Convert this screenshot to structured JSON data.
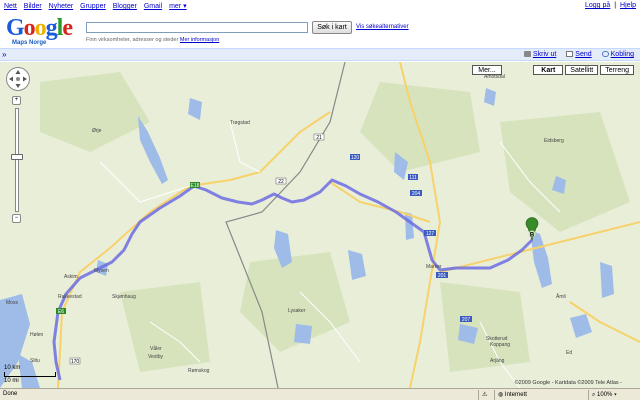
{
  "topnav": {
    "items": [
      "Nett",
      "Bilder",
      "Nyheter",
      "Grupper",
      "Blogger",
      "Gmail",
      "mer ▾"
    ],
    "login": "Logg på",
    "separator": "|",
    "help": "Hjelp"
  },
  "header": {
    "logo_text": "Google",
    "logo_sub": "Maps Norge",
    "search_value": "",
    "search_button": "Søk i kart",
    "options_link": "Vis søkealternativer",
    "hint_text": "Finn virksomheter, adresser og steder",
    "hint_link": "Mer informasjon"
  },
  "toolbar": {
    "collapse_glyph": "»",
    "print": "Skriv ut",
    "send": "Send",
    "link": "Kobling"
  },
  "map": {
    "maptypes": [
      "Kart",
      "Satellitt",
      "Terreng"
    ],
    "active_type": "Kart",
    "more": "Mer...",
    "scale_km": "10 km",
    "scale_mi": "10 mi",
    "copyright": "©2009 Google - Kartdata ©2009 Tele Atlas -",
    "marker_label": "B",
    "towns": [
      "Moss",
      "Hølen",
      "Askim",
      "Mysen",
      "Rakkestad",
      "Ørje",
      "Trøgstad",
      "Eidsberg",
      "Skjønhaug",
      "Åmotsdal",
      "Slitu",
      "Vestby",
      "Våler",
      "Rømskog",
      "Marker",
      "Skotterud",
      "Koppang",
      "Åmli",
      "Lysaker",
      "Arjäng",
      "Ed"
    ],
    "road_numbers": [
      "E6",
      "E18",
      "22",
      "21",
      "127",
      "201",
      "120",
      "170",
      "111",
      "204",
      "207"
    ]
  },
  "statusbar": {
    "status": "Done",
    "zone": "Internett",
    "zoom": "100%"
  },
  "colors": {
    "route": "#6c6ce0",
    "water": "#9fbce8",
    "forest": "#d6e3bd",
    "road_major": "#f7d26b",
    "border": "#888888"
  }
}
